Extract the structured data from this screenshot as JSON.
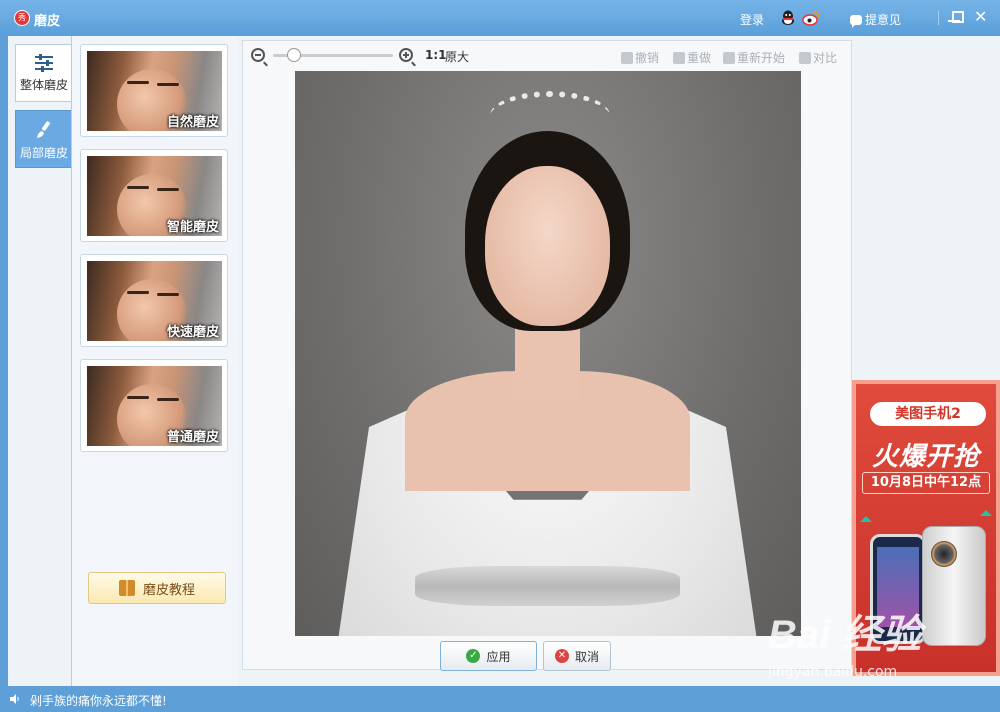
{
  "window": {
    "title": "磨皮",
    "logo_text": "秀",
    "login": "登录",
    "feedback": "提意见"
  },
  "tabs": [
    {
      "label": "整体磨皮",
      "icon": "sliders-icon"
    },
    {
      "label": "局部磨皮",
      "icon": "brush-icon"
    }
  ],
  "effects": [
    {
      "label": "自然磨皮"
    },
    {
      "label": "智能磨皮"
    },
    {
      "label": "快速磨皮"
    },
    {
      "label": "普通磨皮"
    }
  ],
  "tutorial_label": "磨皮教程",
  "toolbar": {
    "zoom_ratio": "1:1",
    "zoom_original": "原大",
    "undo": "撤销",
    "redo": "重做",
    "restart": "重新开始",
    "compare": "对比"
  },
  "actions": {
    "apply": "应用",
    "cancel": "取消"
  },
  "ad": {
    "badge": "美图手机2",
    "headline": "火爆开抢",
    "date": "10月8日中午12点"
  },
  "watermark": {
    "logo": "Bai  经验",
    "url": "jingyan.baidu.com"
  },
  "status": {
    "text": "剁手族的痛你永远都不懂!"
  },
  "colors": {
    "titlebar": "#5a9fd9",
    "accent_tab": "#6aa9e1",
    "ad_red": "#d23428"
  }
}
